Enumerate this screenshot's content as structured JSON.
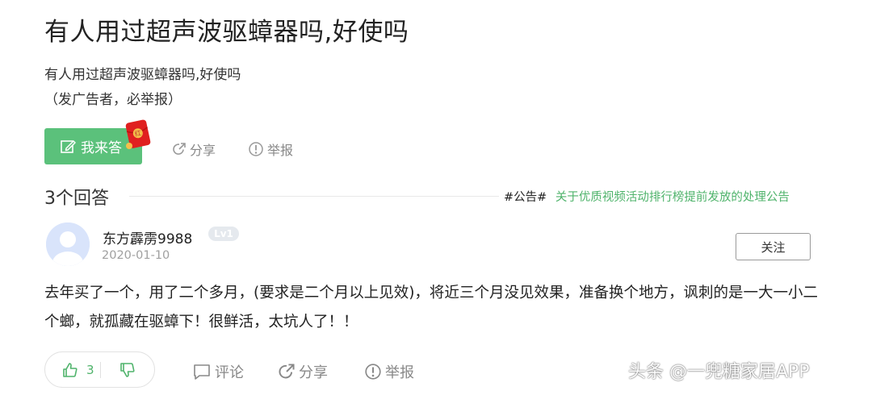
{
  "question": {
    "title": "有人用过超声波驱蟑器吗,好使吗",
    "body_line1": "有人用过超声波驱蟑器吗,好使吗",
    "body_line2": "（发广告者，必举报）"
  },
  "actions": {
    "answer_label": "我来答",
    "share_label": "分享",
    "report_label": "举报"
  },
  "answers_header": {
    "count_label": "3个回答",
    "notice_tag": "#公告#",
    "notice_link": "关于优质视频活动排行榜提前发放的处理公告"
  },
  "answer": {
    "username": "东方霹雳9988",
    "level": "Lv1",
    "date": "2020-01-10",
    "follow_label": "关注",
    "content": "去年买了一个，用了二个多月，(要求是二个月以上见效)，将近三个月没见效果，准备换个地方，讽刺的是一大一小二个螂，就孤藏在驱蟑下！很鲜活，太坑人了！！",
    "likes": "3",
    "comment_label": "评论",
    "share_label": "分享",
    "report_label": "举报"
  },
  "watermark": "头条 @一兜糖家居APP",
  "colors": {
    "accent_green": "#5bc17b",
    "link_green": "#4fb36b",
    "muted_gray": "#888888",
    "red_packet": "#e02020"
  },
  "icons": [
    "edit-icon",
    "red-packet-icon",
    "share-icon",
    "report-icon",
    "avatar-placeholder",
    "thumbs-up-icon",
    "thumbs-down-icon",
    "comment-icon"
  ]
}
